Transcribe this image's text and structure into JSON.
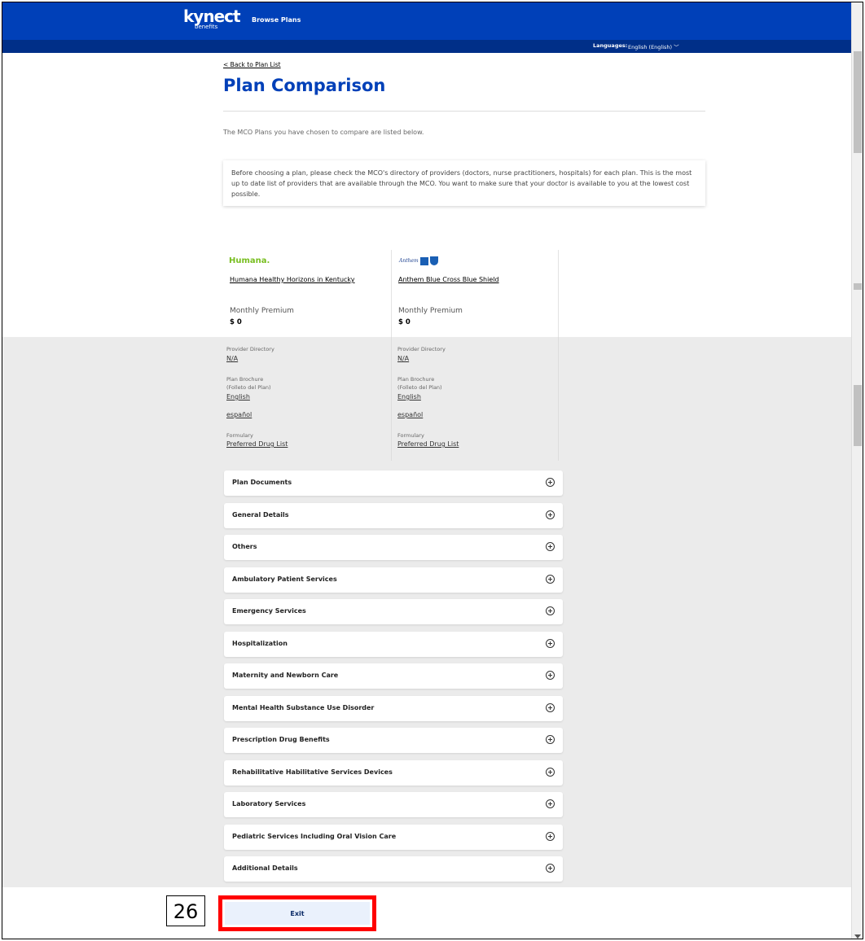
{
  "header": {
    "brand": "kynect",
    "brand_sub": "benefits",
    "nav_browse": "Browse Plans",
    "language_label": "Languages:",
    "language_value": "English (English)"
  },
  "page": {
    "back_link": "< Back to Plan List",
    "title": "Plan Comparison",
    "intro": "The MCO Plans you have chosen to compare are listed below.",
    "notice": "Before choosing a plan, please check the MCO's directory of providers (doctors, nurse practitioners, hospitals) for each plan. This is the most up to date list of providers that are available through the MCO. You want to make sure that your doctor is available to you at the lowest cost possible."
  },
  "plans": [
    {
      "logo_text": "Humana.",
      "name": "Humana Healthy Horizons in Kentucky",
      "premium_label": "Monthly Premium",
      "premium_value": "$ 0",
      "provider_dir_label": "Provider Directory",
      "provider_dir_value": "N/A",
      "brochure_label": "Plan Brochure",
      "brochure_sublabel": "(Folleto del Plan)",
      "brochure_english": "English",
      "brochure_spanish": "español",
      "formulary_label": "Formulary",
      "formulary_value": "Preferred Drug List"
    },
    {
      "logo_text": "Anthem",
      "name": "Anthem Blue Cross Blue Shield",
      "premium_label": "Monthly Premium",
      "premium_value": "$ 0",
      "provider_dir_label": "Provider Directory",
      "provider_dir_value": "N/A",
      "brochure_label": "Plan Brochure",
      "brochure_sublabel": "(Folleto del Plan)",
      "brochure_english": "English",
      "brochure_spanish": "español",
      "formulary_label": "Formulary",
      "formulary_value": "Preferred Drug List"
    }
  ],
  "sections": [
    "Plan Documents",
    "General Details",
    "Others",
    "Ambulatory Patient Services",
    "Emergency Services",
    "Hospitalization",
    "Maternity and Newborn Care",
    "Mental Health Substance Use Disorder",
    "Prescription Drug Benefits",
    "Rehabilitative Habilitative Services Devices",
    "Laboratory Services",
    "Pediatric Services Including Oral Vision Care",
    "Additional Details"
  ],
  "footer": {
    "exit_label": "Exit",
    "step_number": "26"
  }
}
